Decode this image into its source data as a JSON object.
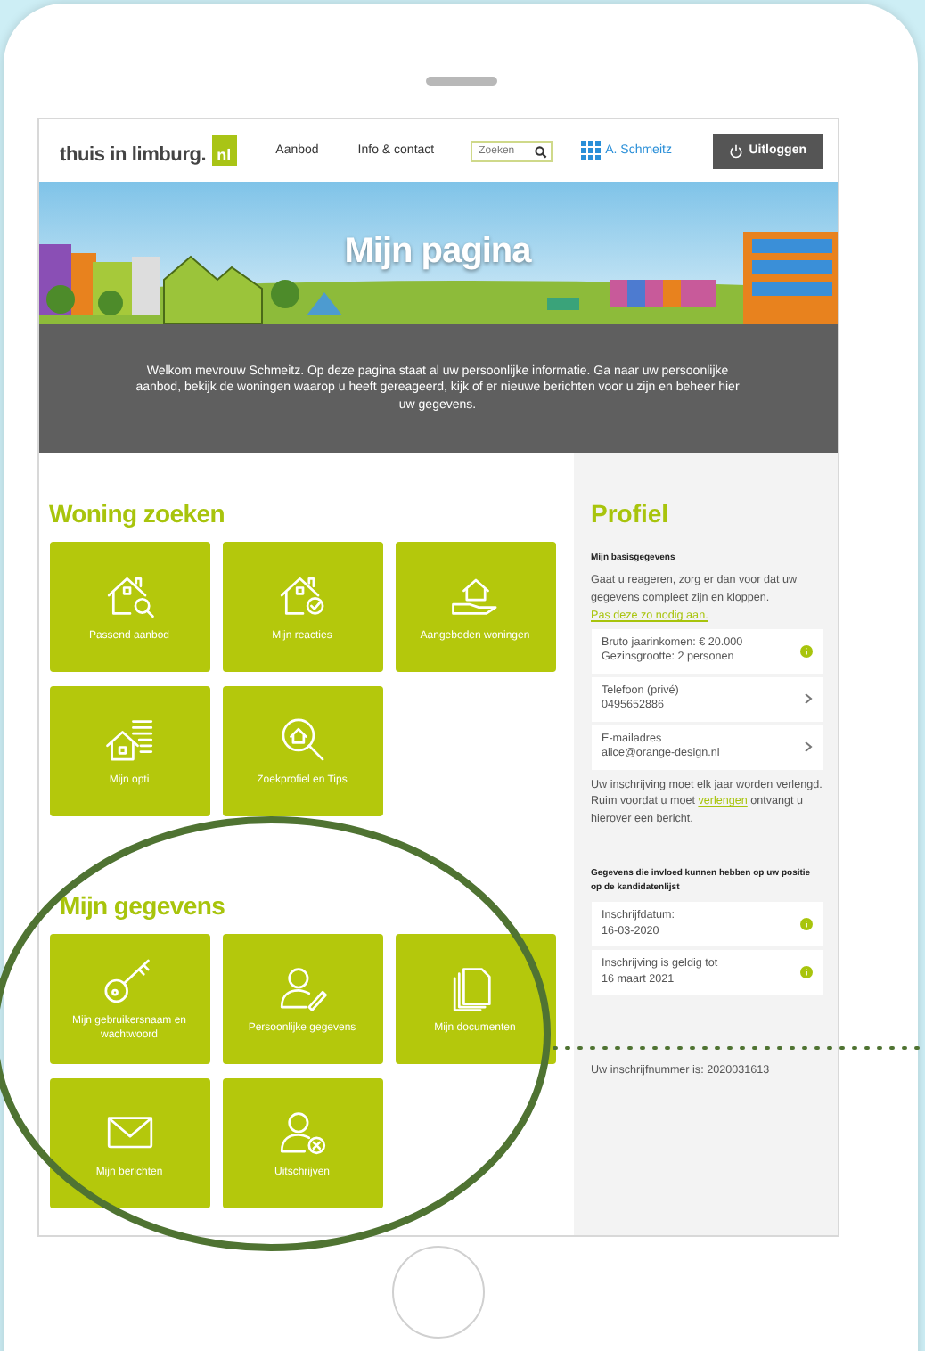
{
  "header": {
    "logo_text": "thuis in limburg.",
    "logo_badge": "nl",
    "nav": [
      "Aanbod",
      "Info & contact"
    ],
    "search": {
      "placeholder": "Zoeken"
    },
    "user": "A. Schmeitz",
    "logout": "Uitloggen"
  },
  "banner": {
    "title": "Mijn pagina"
  },
  "intro": "Welkom mevrouw Schmeitz. Op deze pagina staat al uw persoonlijke informatie. Ga naar uw persoonlijke aanbod, bekijk de woningen waarop u heeft gereageerd, kijk of er nieuwe berichten voor u zijn en beheer hier uw gegevens.",
  "sections": [
    {
      "title": "Woning zoeken",
      "tiles": [
        {
          "label": "Passend aanbod",
          "kind": "house-search"
        },
        {
          "label": "Mijn reacties",
          "kind": "house-check"
        },
        {
          "label": "Aangeboden woningen",
          "kind": "house-hand"
        },
        {
          "label": "Mijn opti",
          "kind": "house-list"
        },
        {
          "label": "Zoekprofiel en Tips",
          "kind": "magnifier-house"
        }
      ]
    },
    {
      "title": "Mijn gegevens",
      "tiles": [
        {
          "label": "Mijn gebruikersnaam en wachtwoord",
          "kind": "key"
        },
        {
          "label": "Persoonlijke gegevens",
          "kind": "person-pencil"
        },
        {
          "label": "Mijn documenten",
          "kind": "documents"
        },
        {
          "label": "Mijn berichten",
          "kind": "envelope"
        },
        {
          "label": "Uitschrijven",
          "kind": "person-cross"
        }
      ]
    }
  ],
  "profile": {
    "title": "Profiel",
    "subtitle": "Mijn basisgegevens",
    "text": "Gaat u reageren, zorg er dan voor dat uw gegevens compleet zijn en kloppen.",
    "text_link": "Pas deze zo nodig aan.",
    "cards": [
      {
        "kind": "info",
        "lines": [
          "Bruto jaarinkomen: € 20.000",
          "Gezinsgrootte: 2 personen"
        ]
      },
      {
        "kind": "chevron",
        "lines": [
          "Telefoon (privé)",
          "0495652886"
        ]
      },
      {
        "kind": "chevron",
        "lines": [
          "E-mailadres",
          "alice@orange-design.nl"
        ]
      }
    ],
    "renewal_before": "Uw inschrijving moet elk jaar worden verlengd. Ruim voordat u moet",
    "renewal_link": "verlengen",
    "renewal_after": "ontvangt u hierover een bericht.",
    "subheading": "Gegevens die invloed kunnen hebben op uw positie op de kandidatenlijst",
    "cards2": [
      {
        "kind": "info",
        "lines": [
          "Inschrijfdatum:",
          "16-03-2020"
        ]
      },
      {
        "kind": "info",
        "lines": [
          "Inschrijving is geldig tot",
          "16 maart 2021"
        ]
      }
    ],
    "footer": "Uw inschrijfnummer is: 2020031613"
  }
}
